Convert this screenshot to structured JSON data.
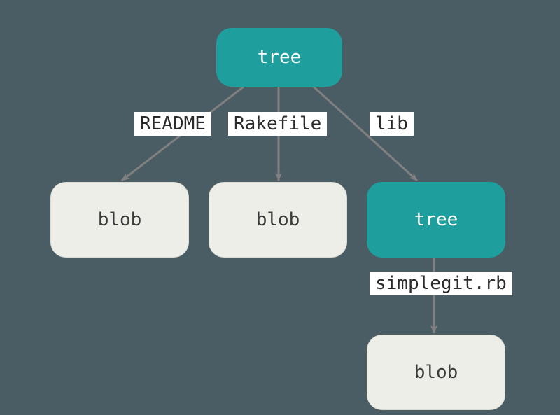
{
  "nodes": {
    "root": {
      "label": "tree"
    },
    "child1": {
      "label": "blob"
    },
    "child2": {
      "label": "blob"
    },
    "child3": {
      "label": "tree"
    },
    "leaf": {
      "label": "blob"
    }
  },
  "edges": {
    "e1": {
      "label": "README"
    },
    "e2": {
      "label": "Rakefile"
    },
    "e3": {
      "label": "lib"
    },
    "e4": {
      "label": "simplegit.rb"
    }
  }
}
